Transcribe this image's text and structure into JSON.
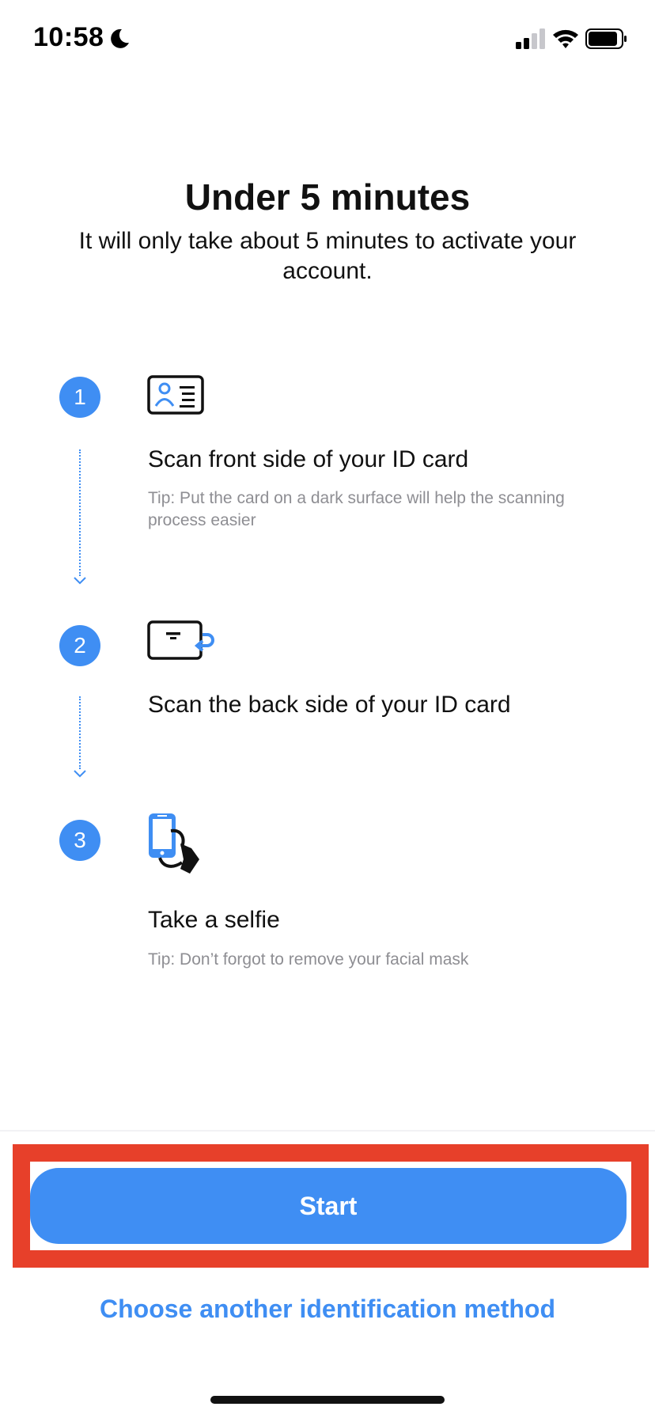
{
  "status_bar": {
    "time": "10:58",
    "icons": [
      "moon-icon",
      "cellular-signal-icon",
      "wifi-icon",
      "battery-icon"
    ]
  },
  "header": {
    "title": "Under 5 minutes",
    "subtitle": "It will only take about 5 minutes to activate your account."
  },
  "steps": [
    {
      "number": "1",
      "icon": "id-card-front-icon",
      "title": "Scan front side of your ID card",
      "tip": "Tip: Put the card on a dark surface will help the scanning process easier"
    },
    {
      "number": "2",
      "icon": "id-card-back-icon",
      "title": "Scan the back side of your ID card",
      "tip": ""
    },
    {
      "number": "3",
      "icon": "selfie-phone-icon",
      "title": "Take a selfie",
      "tip": "Tip: Don’t forgot to remove your facial mask"
    }
  ],
  "actions": {
    "start_label": "Start",
    "other_method_label": "Choose another identification method"
  },
  "colors": {
    "accent": "#3f8ef3",
    "highlight": "#e7402a",
    "tip_text": "#8e8e93"
  }
}
